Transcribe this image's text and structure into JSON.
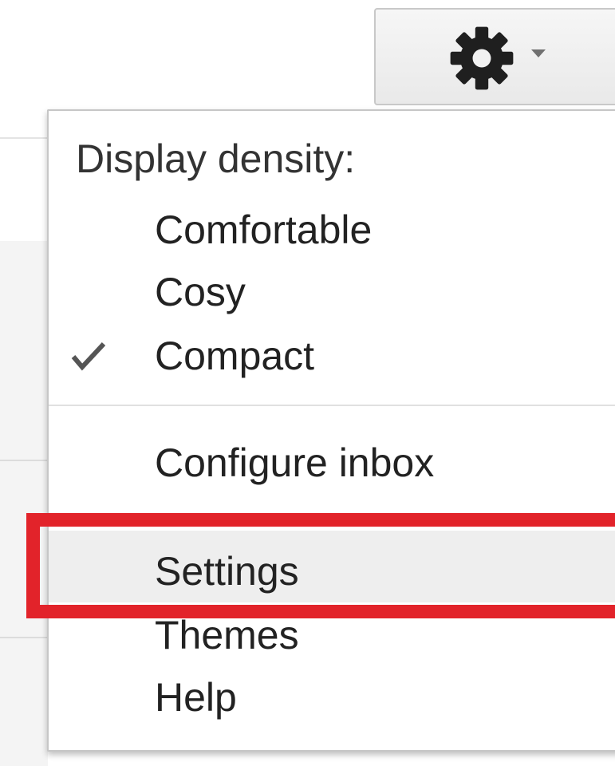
{
  "toolbar": {
    "settings_button_icon": "gear-icon",
    "dropdown_indicator_icon": "caret-down-icon"
  },
  "menu": {
    "density_heading": "Display density:",
    "density_options": [
      {
        "label": "Comfortable",
        "checked": false
      },
      {
        "label": "Cosy",
        "checked": false
      },
      {
        "label": "Compact",
        "checked": true
      }
    ],
    "items": [
      {
        "label": "Configure inbox"
      },
      {
        "label": "Settings",
        "highlighted": true
      },
      {
        "label": "Themes"
      },
      {
        "label": "Help"
      }
    ]
  },
  "colors": {
    "annotation_border": "#e2232a",
    "hover_background": "#eeeeee",
    "icon_color": "#1f1f1f",
    "checkmark_color": "#555555"
  }
}
